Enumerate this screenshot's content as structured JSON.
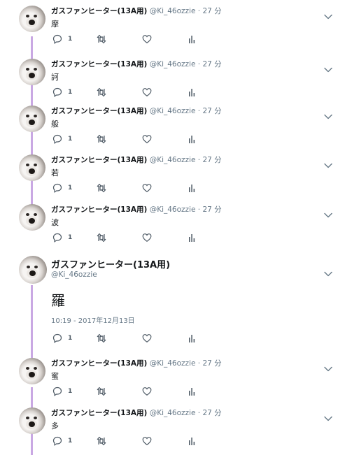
{
  "author": {
    "name": "ガスファンヒーター(13A用)",
    "handle": "@Ki_46ozzie"
  },
  "tweets": [
    {
      "time": "27 分",
      "text": "摩",
      "reply_count": "1"
    },
    {
      "time": "27 分",
      "text": "訶",
      "reply_count": "1"
    },
    {
      "time": "27 分",
      "text": "般",
      "reply_count": "1"
    },
    {
      "time": "27 分",
      "text": "若",
      "reply_count": "1"
    },
    {
      "time": "27 分",
      "text": "波",
      "reply_count": "1"
    }
  ],
  "focused_tweet": {
    "text": "羅",
    "date": "10:19 - 2017年12月13日",
    "reply_count": "1"
  },
  "replies": [
    {
      "time": "27 分",
      "text": "蜜",
      "reply_count": "1"
    },
    {
      "time": "27 分",
      "text": "多",
      "reply_count": "1"
    }
  ],
  "separator": "·",
  "colors": {
    "thread_line": "#c9a8e3",
    "secondary_text": "#657786",
    "icon": "#4f5b66"
  },
  "icons": {
    "reply": "reply-icon",
    "retweet": "retweet-icon",
    "like": "heart-icon",
    "analytics": "analytics-icon",
    "caret": "chevron-down-icon"
  }
}
